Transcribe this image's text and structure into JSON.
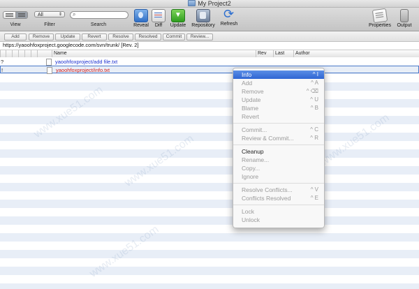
{
  "window": {
    "title": "My Project2"
  },
  "toolbar": {
    "filter_value": "All",
    "labels": {
      "view": "View",
      "filter": "Filter",
      "search": "Search"
    },
    "buttons": [
      {
        "label": "Reveal",
        "icon": "finder-icon"
      },
      {
        "label": "Diff",
        "icon": "diff-icon"
      },
      {
        "label": "Update",
        "icon": "update-arrow-icon"
      },
      {
        "label": "Repository",
        "icon": "repository-icon"
      },
      {
        "label": "Refresh",
        "icon": "refresh-icon"
      },
      {
        "label": "Properties",
        "icon": "properties-icon"
      },
      {
        "label": "Output",
        "icon": "output-icon"
      }
    ]
  },
  "actions": [
    "Add",
    "Remove",
    "Update",
    "Revert",
    "Resolve",
    "Resolved",
    "Commit",
    "Review..."
  ],
  "url": "https://yaoohfoxproject.googlecode.com/svn/trunk/  [Rev. 2]",
  "columns": {
    "name": "Name",
    "rev": "Rev",
    "last": "Last",
    "author": "Author"
  },
  "files": [
    {
      "status": "?",
      "name": "yaoohfoxproject/add file.txt",
      "color": "#1a2fd0"
    },
    {
      "status": "!",
      "name": "yaoohfoxproject/info.txt",
      "color": "#d01a1a"
    }
  ],
  "context_menu": {
    "items": [
      {
        "label": "Info",
        "key": "^ I",
        "state": "highlighted"
      },
      {
        "label": "Add",
        "key": "^ A",
        "state": "disabled"
      },
      {
        "label": "Remove",
        "key": "^ ⌫",
        "state": "disabled"
      },
      {
        "label": "Update",
        "key": "^ U",
        "state": "disabled"
      },
      {
        "label": "Blame",
        "key": "^ B",
        "state": "disabled"
      },
      {
        "label": "Revert",
        "key": "",
        "state": "disabled"
      },
      {
        "label": "Commit...",
        "key": "^ C",
        "state": "disabled"
      },
      {
        "label": "Review & Commit...",
        "key": "^ R",
        "state": "disabled"
      },
      {
        "label": "Cleanup",
        "key": "",
        "state": "enabled"
      },
      {
        "label": "Rename...",
        "key": "",
        "state": "disabled"
      },
      {
        "label": "Copy...",
        "key": "",
        "state": "disabled"
      },
      {
        "label": "Ignore",
        "key": "",
        "state": "disabled"
      },
      {
        "label": "Resolve Conflicts...",
        "key": "^ V",
        "state": "disabled"
      },
      {
        "label": "Conflicts Resolved",
        "key": "^ E",
        "state": "disabled"
      },
      {
        "label": "Lock",
        "key": "",
        "state": "disabled"
      },
      {
        "label": "Unlock",
        "key": "",
        "state": "disabled"
      }
    ]
  },
  "watermark": "www.xue51.com"
}
